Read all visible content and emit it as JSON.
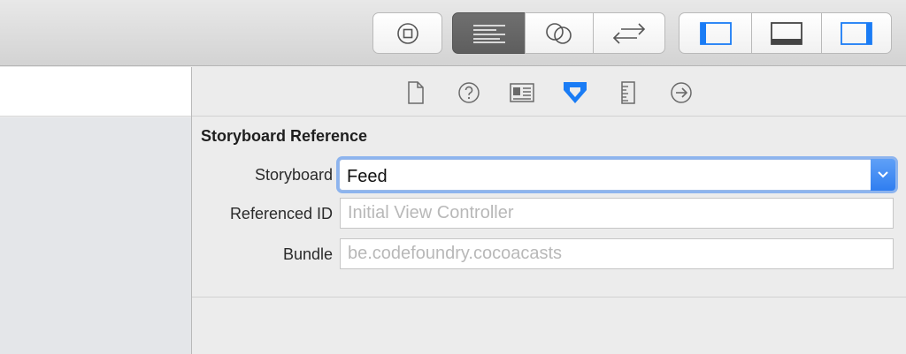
{
  "toolbar": {
    "buttons": [
      {
        "name": "stop",
        "icon": "stop-icon"
      },
      {
        "name": "standard-editor",
        "icon": "standard-editor-icon",
        "active": true
      },
      {
        "name": "assistant-editor",
        "icon": "assistant-editor-icon"
      },
      {
        "name": "version-editor",
        "icon": "version-editor-icon"
      },
      {
        "name": "toggle-navigator",
        "icon": "left-panel-icon"
      },
      {
        "name": "toggle-debug-area",
        "icon": "bottom-panel-icon"
      },
      {
        "name": "toggle-utilities",
        "icon": "right-panel-icon"
      }
    ],
    "accent_color": "#1a7cf5"
  },
  "inspector": {
    "tabs": [
      {
        "name": "file-inspector",
        "icon": "file-icon"
      },
      {
        "name": "quick-help",
        "icon": "help-icon"
      },
      {
        "name": "identity-inspector",
        "icon": "identity-card-icon"
      },
      {
        "name": "attributes-inspector",
        "icon": "attributes-icon",
        "active": true
      },
      {
        "name": "size-inspector",
        "icon": "ruler-icon"
      },
      {
        "name": "connections-inspector",
        "icon": "arrow-circle-icon"
      }
    ],
    "section_title": "Storyboard Reference",
    "fields": {
      "storyboard": {
        "label": "Storyboard",
        "value": "Feed"
      },
      "referenced_id": {
        "label": "Referenced ID",
        "value": "",
        "placeholder": "Initial View Controller"
      },
      "bundle": {
        "label": "Bundle",
        "value": "",
        "placeholder": "be.codefoundry.cocoacasts"
      }
    }
  }
}
